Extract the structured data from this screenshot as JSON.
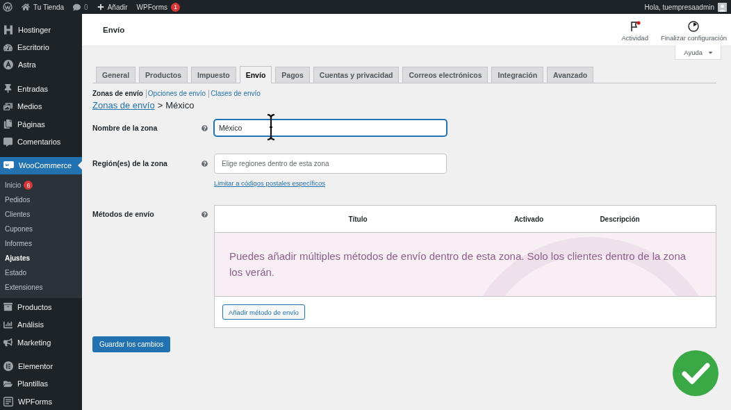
{
  "admin_bar": {
    "site": "Tu Tienda",
    "comments": "0",
    "new": "Añadir",
    "plugin": {
      "label": "WPForms",
      "badge": "1"
    },
    "account": "Hola, tuempresaadmin"
  },
  "sidebar": {
    "groups": [
      {
        "items": [
          {
            "label": "Hostinger",
            "selected": false
          },
          {
            "label": "Escritorio",
            "selected": false
          },
          {
            "label": "Astra",
            "selected": false
          }
        ]
      },
      {
        "items": [
          {
            "label": "Entradas",
            "selected": false
          },
          {
            "label": "Medios",
            "selected": false
          },
          {
            "label": "Páginas",
            "selected": false
          },
          {
            "label": "Comentarios",
            "selected": false
          }
        ]
      },
      {
        "items": [
          {
            "label": "WooCommerce",
            "selected": true,
            "children": [
              {
                "label": "Inicio",
                "badge": "6",
                "selected": false
              },
              {
                "label": "Pedidos",
                "selected": false
              },
              {
                "label": "Clientes",
                "selected": false
              },
              {
                "label": "Cupones",
                "selected": false
              },
              {
                "label": "Informes",
                "selected": false
              },
              {
                "label": "Ajustes",
                "selected": true
              },
              {
                "label": "Estado",
                "selected": false
              },
              {
                "label": "Extensiones",
                "selected": false
              }
            ]
          },
          {
            "label": "Productos",
            "selected": false
          },
          {
            "label": "Análisis",
            "selected": false
          },
          {
            "label": "Marketing",
            "selected": false
          }
        ]
      },
      {
        "items": [
          {
            "label": "Elementor",
            "selected": false
          },
          {
            "label": "Plantillas",
            "selected": false
          },
          {
            "label": "WPForms",
            "selected": false
          }
        ]
      }
    ]
  },
  "header": {
    "title": "Envío",
    "actions": [
      {
        "label": "Actividad",
        "notification": true
      },
      {
        "label": "Finalizar configuración",
        "notification": false
      }
    ]
  },
  "help_button": "Ayuda",
  "tabs": [
    {
      "label": "General",
      "selected": false
    },
    {
      "label": "Productos",
      "selected": false
    },
    {
      "label": "Impuesto",
      "selected": false
    },
    {
      "label": "Envío",
      "selected": true
    },
    {
      "label": "Pagos",
      "selected": false
    },
    {
      "label": "Cuentas y privacidad",
      "selected": false
    },
    {
      "label": "Correos electrónicos",
      "selected": false
    },
    {
      "label": "Integración",
      "selected": false
    },
    {
      "label": "Avanzado",
      "selected": false
    }
  ],
  "subnav": [
    {
      "label": "Zonas de envío",
      "selected": true
    },
    {
      "label": "Opciones de envío",
      "selected": false
    },
    {
      "label": "Clases de envío",
      "selected": false
    }
  ],
  "breadcrumb": {
    "link": "Zonas de envío",
    "separator": ">",
    "current": "México"
  },
  "form": {
    "zone_name": {
      "label": "Nombre de la zona",
      "value": "México",
      "focused": true
    },
    "zone_regions": {
      "label": "Región(es) de la zona",
      "placeholder": "Elige regiones dentro de esta zona",
      "link": "Limitar a códigos postales específicos"
    },
    "shipping_methods": {
      "label": "Métodos de envío",
      "table": {
        "columns": [
          "Título",
          "Activado",
          "Descripción"
        ],
        "empty_message": "Puedes añadir múltiples métodos de envío dentro de esta zona. Solo los clientes dentro de la zona los verán.",
        "add_button": "Añadir método de envío"
      }
    }
  },
  "save_button": "Guardar los cambios"
}
